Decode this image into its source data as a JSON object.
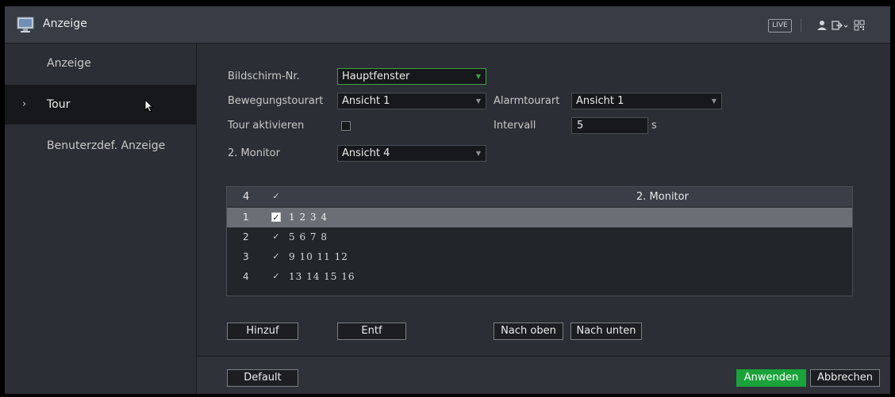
{
  "window": {
    "title": "Anzeige",
    "live_badge": "LIVE"
  },
  "sidebar": {
    "items": [
      {
        "label": "Anzeige"
      },
      {
        "label": "Tour",
        "chevron": "›"
      },
      {
        "label": "Benuterzdef. Anzeige"
      }
    ]
  },
  "form": {
    "screen_label": "Bildschirm-Nr.",
    "screen_value": "Hauptfenster",
    "motion_tour_label": "Bewegungstourart",
    "motion_tour_value": "Ansicht 1",
    "alarm_tour_label": "Alarmtourart",
    "alarm_tour_value": "Ansicht 1",
    "tour_enable_label": "Tour aktivieren",
    "interval_label": "Intervall",
    "interval_value": "5",
    "interval_unit": "s",
    "monitor2_label": "2. Monitor",
    "monitor2_value": "Ansicht 4"
  },
  "table": {
    "header": {
      "num": "4",
      "check": "✓",
      "title": "2. Monitor"
    },
    "rows": [
      {
        "num": "1",
        "check": "✓",
        "channels": "1 2 3 4"
      },
      {
        "num": "2",
        "check": "✓",
        "channels": "5 6 7 8"
      },
      {
        "num": "3",
        "check": "✓",
        "channels": "9 10 11 12"
      },
      {
        "num": "4",
        "check": "✓",
        "channels": "13 14 15 16"
      }
    ]
  },
  "buttons": {
    "add": "Hinzuf",
    "delete": "Entf",
    "move_up": "Nach oben",
    "move_down": "Nach unten",
    "default": "Default",
    "apply": "Anwenden",
    "cancel": "Abbrechen"
  },
  "icons": [
    "monitor-icon",
    "user-icon",
    "logout-icon",
    "qr-code-icon",
    "chevron-right-icon",
    "mouse-cursor-icon",
    "dropdown-arrow-icon",
    "checkbox-icon"
  ],
  "colors": {
    "accent_green": "#1aa33b",
    "focus_green": "#43a047",
    "background": "#2b2e34",
    "selected_row": "#6b6e74"
  }
}
